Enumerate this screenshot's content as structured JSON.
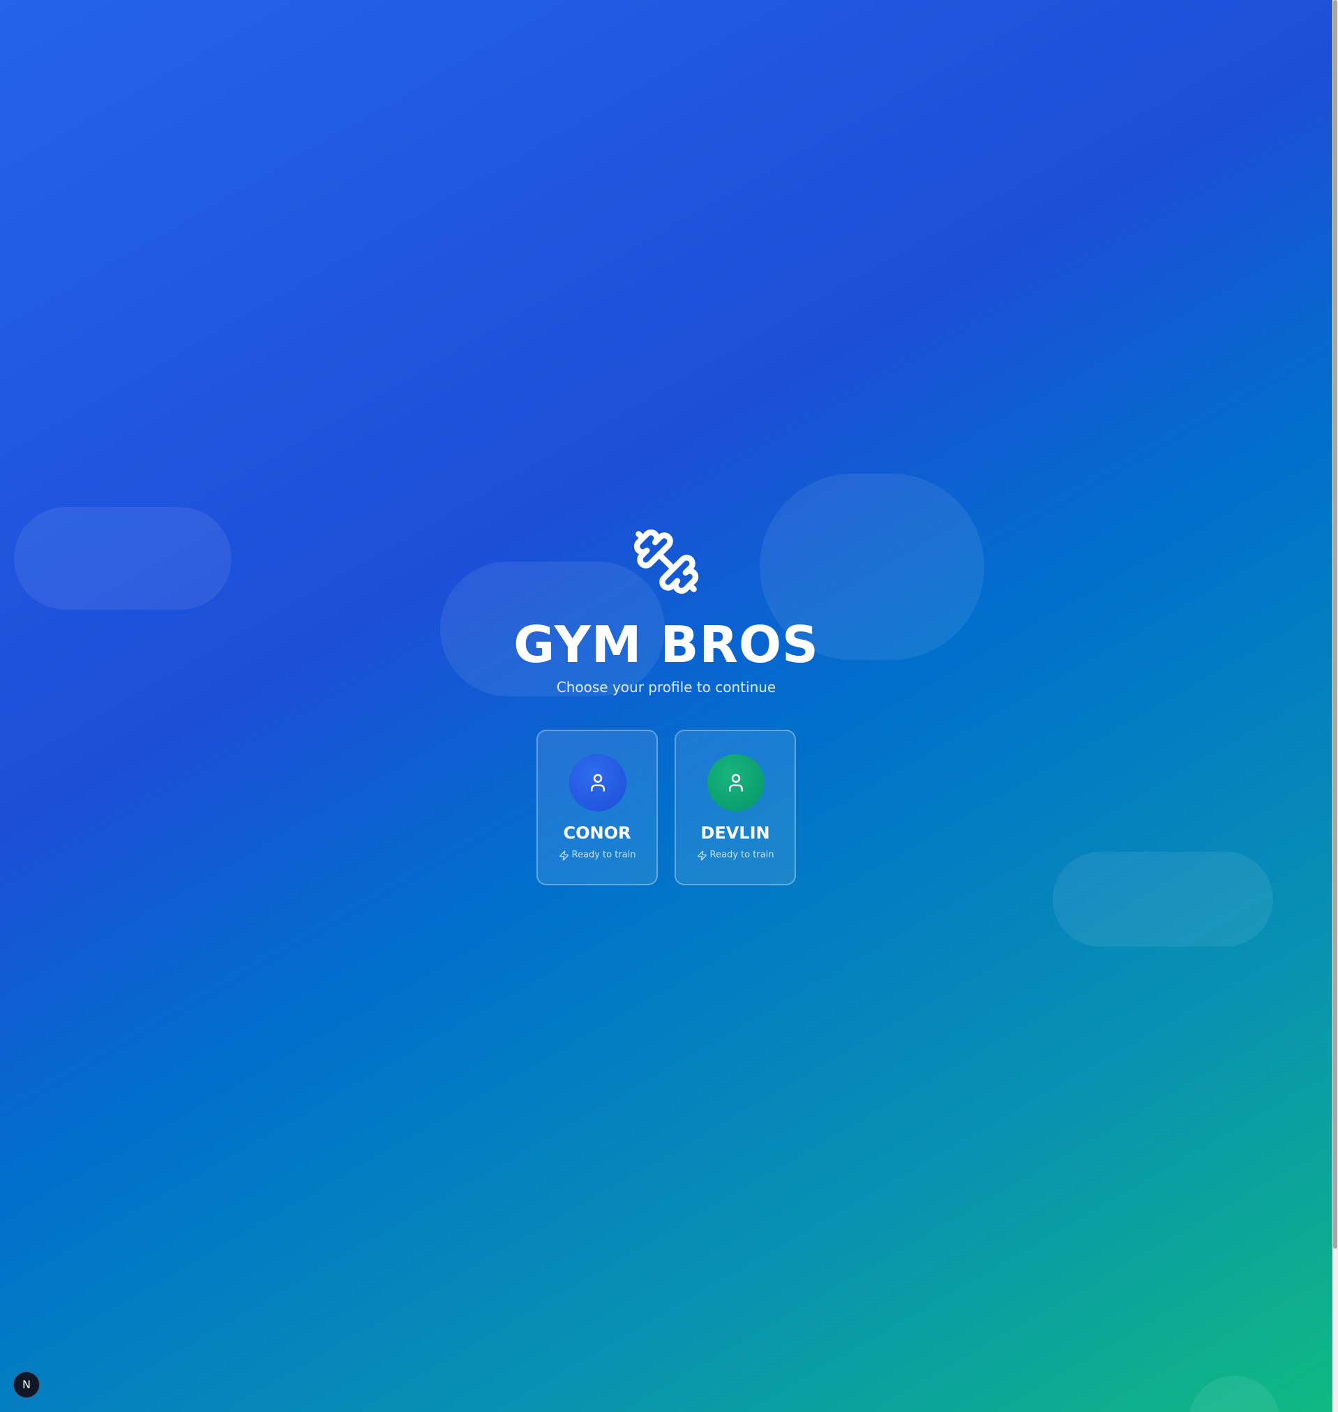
{
  "app": {
    "title": "GYM BROS",
    "subtitle": "Choose your profile to continue",
    "logo_icon": "dumbbell-icon"
  },
  "profiles": [
    {
      "name": "CONOR",
      "status": "Ready to train",
      "avatar_icon": "user-icon",
      "status_icon": "lightning-icon",
      "color": "#1d4ed8"
    },
    {
      "name": "DEVLIN",
      "status": "Ready to train",
      "avatar_icon": "user-icon",
      "status_icon": "lightning-icon",
      "color": "#059669"
    }
  ],
  "dev_badge": {
    "label": "N"
  },
  "colors": {
    "gradient_start": "#2563eb",
    "gradient_mid": "#1d4ed8",
    "gradient_end": "#10b981",
    "text": "#ffffff"
  }
}
